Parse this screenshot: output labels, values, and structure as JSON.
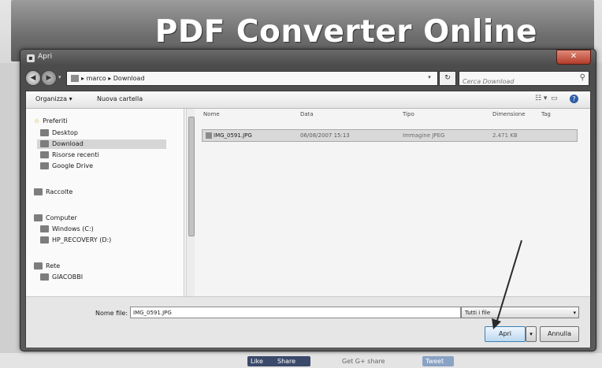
{
  "banner": {
    "title": "PDF Converter Online"
  },
  "dialog": {
    "title": "Apri",
    "close_icon": "close-icon",
    "address": {
      "path": "marco ▸ Download",
      "prefix": "▸"
    },
    "search": {
      "placeholder": "Cerca Download"
    },
    "toolbar": {
      "organize": "Organizza ▾",
      "new_folder": "Nuova cartella"
    },
    "nav": {
      "favorites_header": "Preferiti",
      "favorites": [
        "Desktop",
        "Download",
        "Risorse recenti",
        "Google Drive"
      ],
      "libraries_header": "Raccolte",
      "computer_header": "Computer",
      "computer": [
        "Windows (C:)",
        "HP_RECOVERY (D:)"
      ],
      "network_header": "Rete",
      "network": [
        "GIACOBBI"
      ],
      "selected": "Download"
    },
    "columns": [
      "Nome",
      "Data",
      "Tipo",
      "Dimensione",
      "Tag"
    ],
    "files": [
      {
        "name": "IMG_0591.JPG",
        "date": "06/08/2007 15:13",
        "type": "Immagine JPEG",
        "size": "2.471 KB"
      }
    ],
    "footer": {
      "filename_label": "Nome file:",
      "filename_value": "IMG_0591.JPG",
      "filter": "Tutti i file",
      "open": "Apri",
      "cancel": "Annulla"
    }
  },
  "share": {
    "like": "Like",
    "share": "Share",
    "plus": "Get  G+ share",
    "tweet": "Tweet"
  },
  "colors": {
    "banner": "#6d6d6d",
    "dialog_frame": "#555555",
    "primary_button": "#bcd9f0"
  }
}
